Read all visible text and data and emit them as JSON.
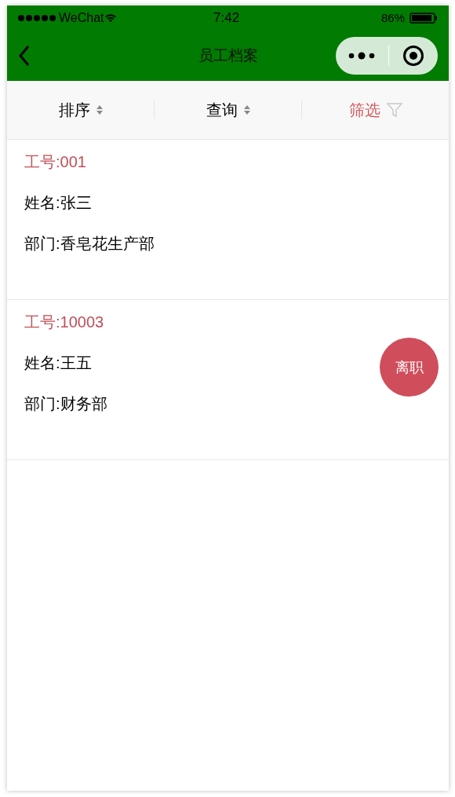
{
  "status_bar": {
    "carrier": "WeChat",
    "time": "7:42",
    "battery": "86%"
  },
  "nav_bar": {
    "title": "员工档案"
  },
  "filter_tabs": [
    {
      "label": "排序",
      "kind": "sort",
      "selected": false
    },
    {
      "label": "查询",
      "kind": "sort",
      "selected": false
    },
    {
      "label": "筛选",
      "kind": "filter",
      "selected": true
    }
  ],
  "employees": [
    {
      "id": "工号:001",
      "name": "姓名:张三",
      "department": "部门:香皂花生产部"
    },
    {
      "id": "工号:10003",
      "name": "姓名:王五",
      "department": "部门:财务部",
      "action": "离职"
    }
  ]
}
